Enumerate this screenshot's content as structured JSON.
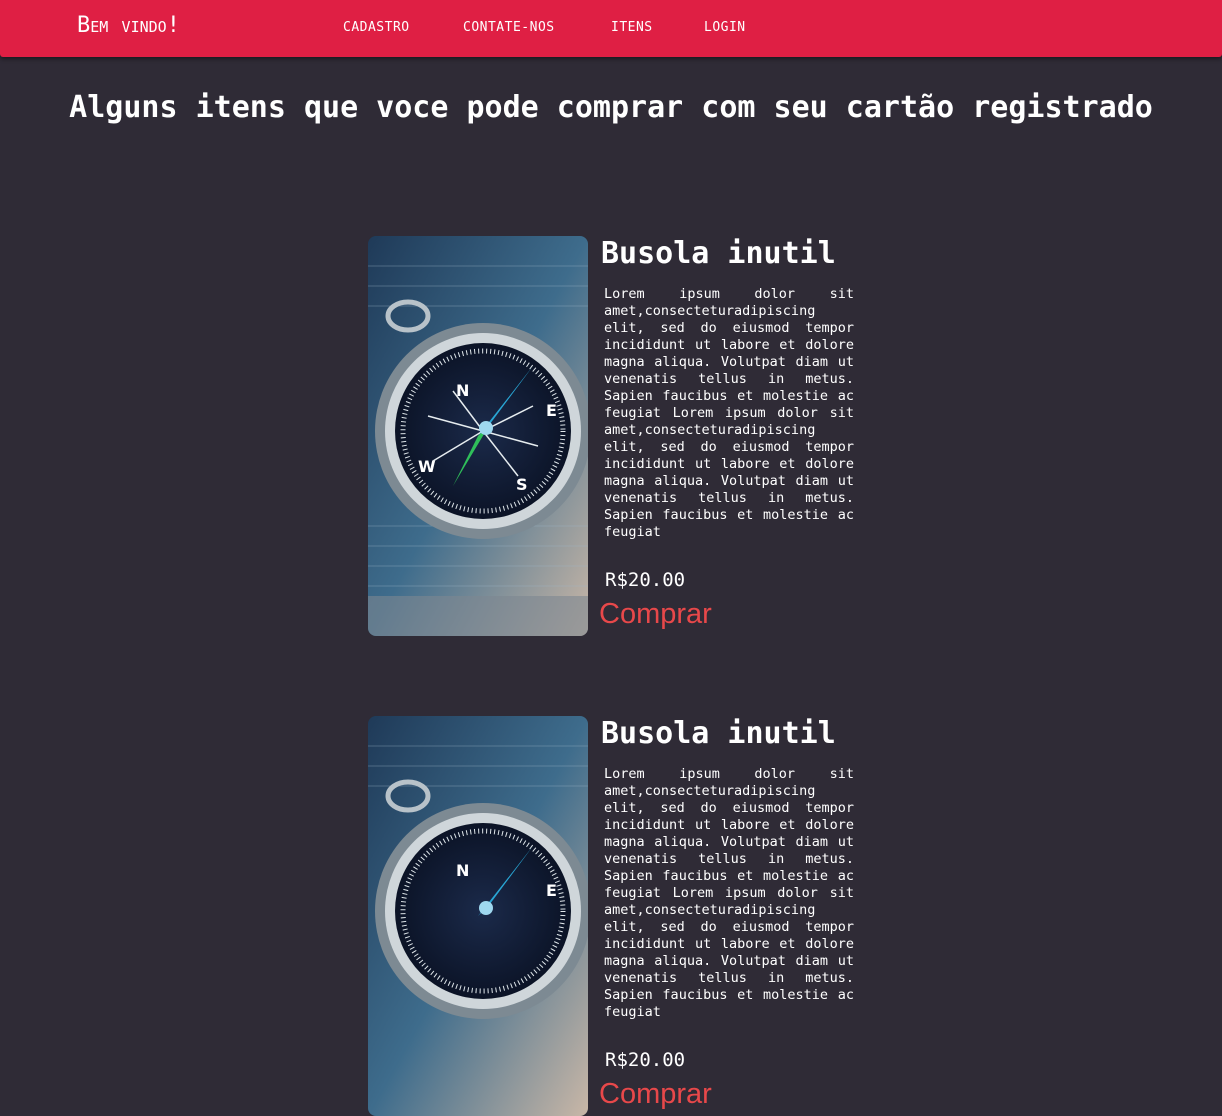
{
  "navbar": {
    "brand": "Bem vindo!",
    "links": [
      "CADASTRO",
      "CONTATE-NOS",
      "ITENS",
      "LOGIN"
    ]
  },
  "page": {
    "title": "Alguns itens que voce pode comprar com seu cartão registrado"
  },
  "items": [
    {
      "title": "Busola inutil",
      "description": "Lorem ipsum dolor sit amet,consecteturadipiscing elit, sed do eiusmod tempor incididunt ut labore et dolore magna aliqua. Volutpat diam ut venenatis tellus in metus. Sapien faucibus et molestie ac feugiat Lorem ipsum dolor sit amet,consecteturadipiscing elit, sed do eiusmod tempor incididunt ut labore et dolore magna aliqua. Volutpat diam ut venenatis tellus in metus. Sapien faucibus et molestie ac feugiat",
      "price": "R$20.00",
      "buy_label": "Comprar",
      "image_icon": "compass-image"
    },
    {
      "title": "Busola inutil",
      "description": "Lorem ipsum dolor sit amet,consecteturadipiscing elit, sed do eiusmod tempor incididunt ut labore et dolore magna aliqua. Volutpat diam ut venenatis tellus in metus. Sapien faucibus et molestie ac feugiat Lorem ipsum dolor sit amet,consecteturadipiscing elit, sed do eiusmod tempor incididunt ut labore et dolore magna aliqua. Volutpat diam ut venenatis tellus in metus. Sapien faucibus et molestie ac feugiat",
      "price": "R$20.00",
      "buy_label": "Comprar",
      "image_icon": "compass-image"
    }
  ],
  "colors": {
    "navbar": "#df1f44",
    "background": "#2f2b36",
    "buy_link": "#e8484a"
  }
}
